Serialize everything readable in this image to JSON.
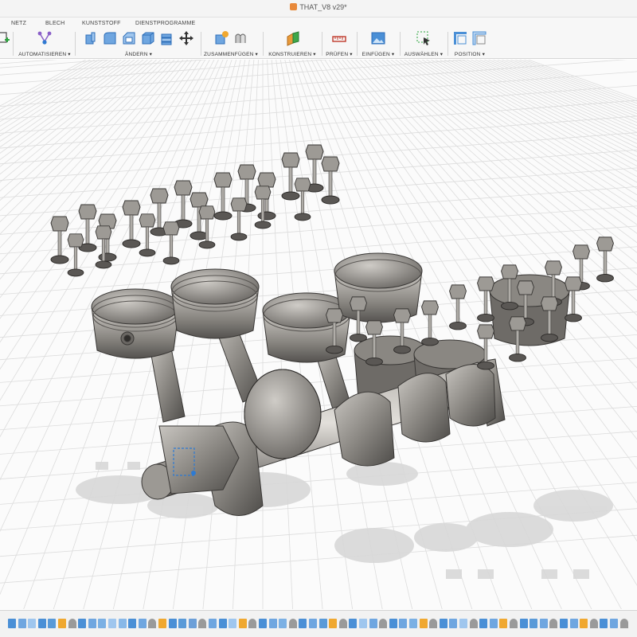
{
  "document": {
    "title": "THAT_V8 v29*"
  },
  "tabs": [
    "NETZ",
    "BLECH",
    "KUNSTSTOFF",
    "DIENSTPROGRAMME"
  ],
  "toolbar": {
    "groups": [
      {
        "id": "automatisieren",
        "label": "AUTOMATISIEREN ▾"
      },
      {
        "id": "aendern",
        "label": "ÄNDERN ▾"
      },
      {
        "id": "zusammenfuegen",
        "label": "ZUSAMMENFÜGEN ▾"
      },
      {
        "id": "konstruieren",
        "label": "KONSTRUIEREN ▾"
      },
      {
        "id": "pruefen",
        "label": "PRÜFEN ▾"
      },
      {
        "id": "einfuegen",
        "label": "EINFÜGEN ▾"
      },
      {
        "id": "auswaehlen",
        "label": "AUSWÄHLEN ▾"
      },
      {
        "id": "position",
        "label": "POSITION ▾"
      }
    ]
  },
  "colors": {
    "accent": "#2e7ad1",
    "grid": "#dcdcdc",
    "metal_light": "#b9b6b1",
    "metal_mid": "#86837f",
    "metal_dark": "#4c4a48",
    "shadow": "#d6d6d6"
  },
  "timeline": {
    "items": [
      "sketch-icon",
      "extrude-icon",
      "fillet-icon",
      "sketch-icon",
      "revolve-icon",
      "component-icon",
      "joint-icon",
      "sketch-icon",
      "extrude-icon",
      "pattern-icon",
      "fillet-icon",
      "chamfer-icon",
      "sketch-icon",
      "extrude-icon",
      "joint-icon",
      "component-icon",
      "sketch-icon",
      "revolve-icon",
      "mirror-icon",
      "joint-icon",
      "extrude-icon",
      "sketch-icon",
      "fillet-icon",
      "component-icon",
      "joint-icon",
      "sketch-icon",
      "extrude-icon",
      "pattern-icon",
      "joint-icon",
      "sketch-icon",
      "extrude-icon",
      "revolve-icon",
      "component-icon",
      "joint-icon",
      "sketch-icon",
      "fillet-icon",
      "extrude-icon",
      "joint-icon",
      "sketch-icon",
      "extrude-icon",
      "pattern-icon",
      "component-icon",
      "joint-icon",
      "sketch-icon",
      "extrude-icon",
      "fillet-icon",
      "joint-icon",
      "sketch-icon",
      "extrude-icon",
      "component-icon",
      "joint-icon",
      "sketch-icon",
      "revolve-icon",
      "extrude-icon",
      "joint-icon",
      "sketch-icon",
      "extrude-icon",
      "component-icon",
      "joint-icon",
      "sketch-icon",
      "extrude-icon",
      "joint-icon"
    ]
  }
}
